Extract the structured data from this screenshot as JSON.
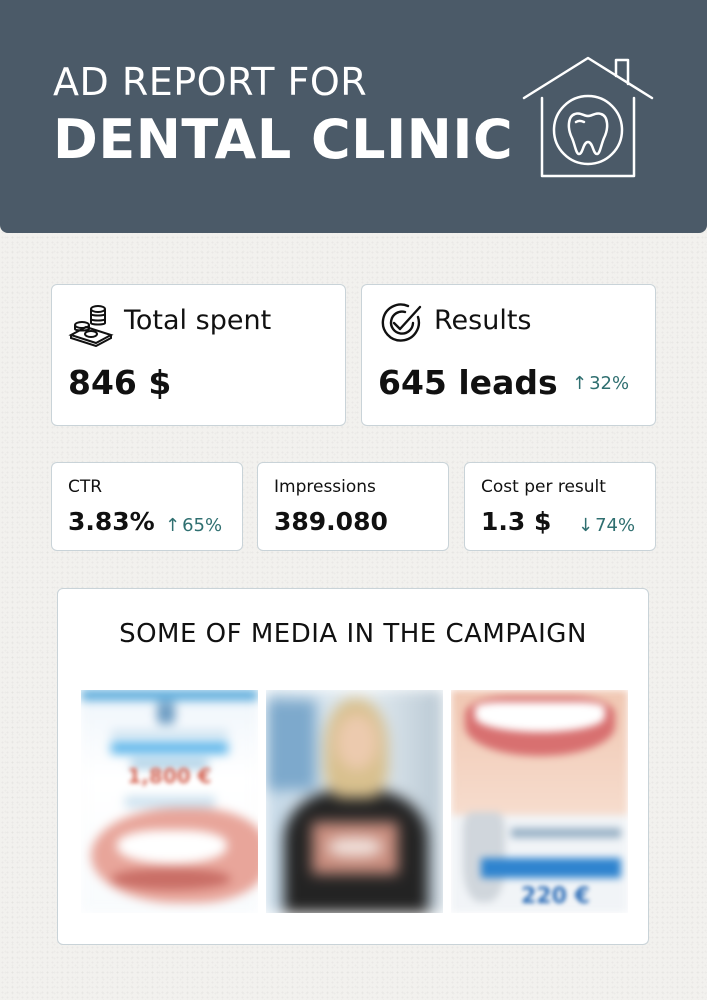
{
  "header": {
    "title_line1": "AD REPORT FOR",
    "title_line2": "DENTAL CLINIC",
    "icon": "dental-house-icon",
    "background": "#4b5a68"
  },
  "stats": {
    "total_spent": {
      "label": "Total spent",
      "value": "846 $",
      "icon": "money-stack-icon"
    },
    "results": {
      "label": "Results",
      "value": "645 leads",
      "trend": "32%",
      "trend_direction": "up",
      "icon": "target-check-icon"
    },
    "ctr": {
      "label": "CTR",
      "value": "3.83%",
      "trend": "65%",
      "trend_direction": "up"
    },
    "impressions": {
      "label": "Impressions",
      "value": "389.080"
    },
    "cost_per_result": {
      "label": "Cost per result",
      "value": "1.3 $",
      "trend": "74%",
      "trend_direction": "down"
    }
  },
  "media": {
    "title": "SOME OF MEDIA IN THE CAMPAIGN",
    "items": [
      {
        "name": "poster-smile-ad",
        "price": "1,800 €"
      },
      {
        "name": "video-testimonial"
      },
      {
        "name": "implant-smile-ad",
        "price": "220 €"
      }
    ]
  },
  "colors": {
    "accent": "#2f6f70",
    "card_border": "#c9d3d8",
    "page_bg": "#f2f1ee"
  },
  "arrows": {
    "up": "↑",
    "down": "↓"
  }
}
